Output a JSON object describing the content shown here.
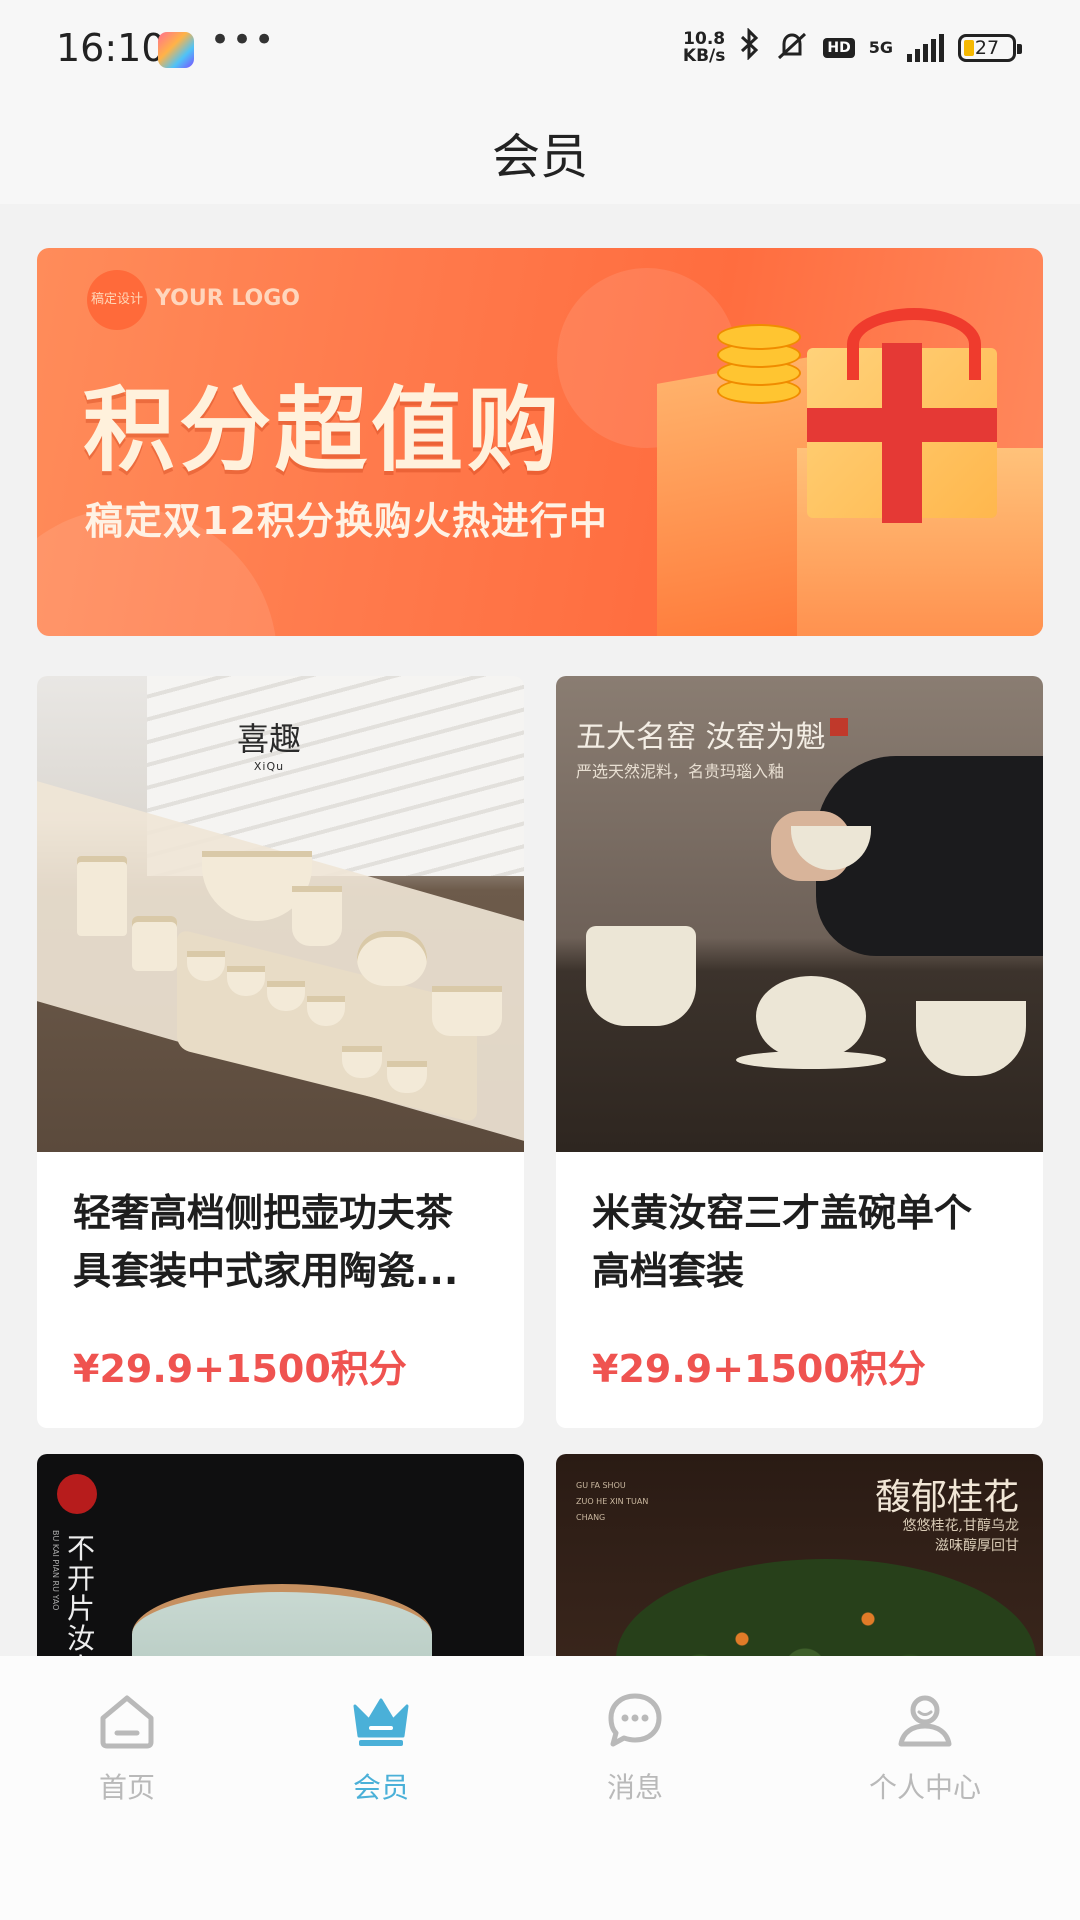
{
  "status_bar": {
    "time": "16:10",
    "more": "•••",
    "net_speed_value": "10.8",
    "net_speed_unit": "KB/s",
    "network": "5G",
    "hd": "HD",
    "battery": "27"
  },
  "header": {
    "title": "会员"
  },
  "banner": {
    "logo_badge": "稿定设计",
    "logo_text": "YOUR LOGO",
    "headline": "积分超值购",
    "subline": "稿定双12积分换购火热进行中"
  },
  "products": [
    {
      "name": "轻奢高档侧把壶功夫茶具套装中式家用陶瓷...",
      "price": "¥29.9+1500积分",
      "image_brand": "喜趣",
      "image_brand_sub": "XiQu"
    },
    {
      "name": "米黄汝窑三才盖碗单个高档套装",
      "price": "¥29.9+1500积分",
      "image_title": "五大名窑 汝窑为魁",
      "image_sub": "严选天然泥料，名贵玛瑙入釉"
    },
    {
      "image_title": "不开片汝窑",
      "image_pinyin": "BU KAI PIAN RU YAO"
    },
    {
      "image_title": "馥郁桂花",
      "image_sub1": "悠悠桂花,甘醇乌龙",
      "image_sub2": "滋味醇厚回甘",
      "image_small1": "GU FA SHOU",
      "image_small2": "ZUO HE XIN TUAN",
      "image_small3": "CHANG"
    }
  ],
  "bottom_nav": {
    "items": [
      {
        "label": "首页",
        "icon": "home-icon",
        "active": false
      },
      {
        "label": "会员",
        "icon": "crown-icon",
        "active": true
      },
      {
        "label": "消息",
        "icon": "chat-bubble-icon",
        "active": false
      },
      {
        "label": "个人中心",
        "icon": "person-icon",
        "active": false
      }
    ],
    "active_color": "#4ab0d8",
    "inactive_color": "#b9b9b9"
  },
  "colors": {
    "price": "#ef5350",
    "banner": "#ff7a4c"
  }
}
